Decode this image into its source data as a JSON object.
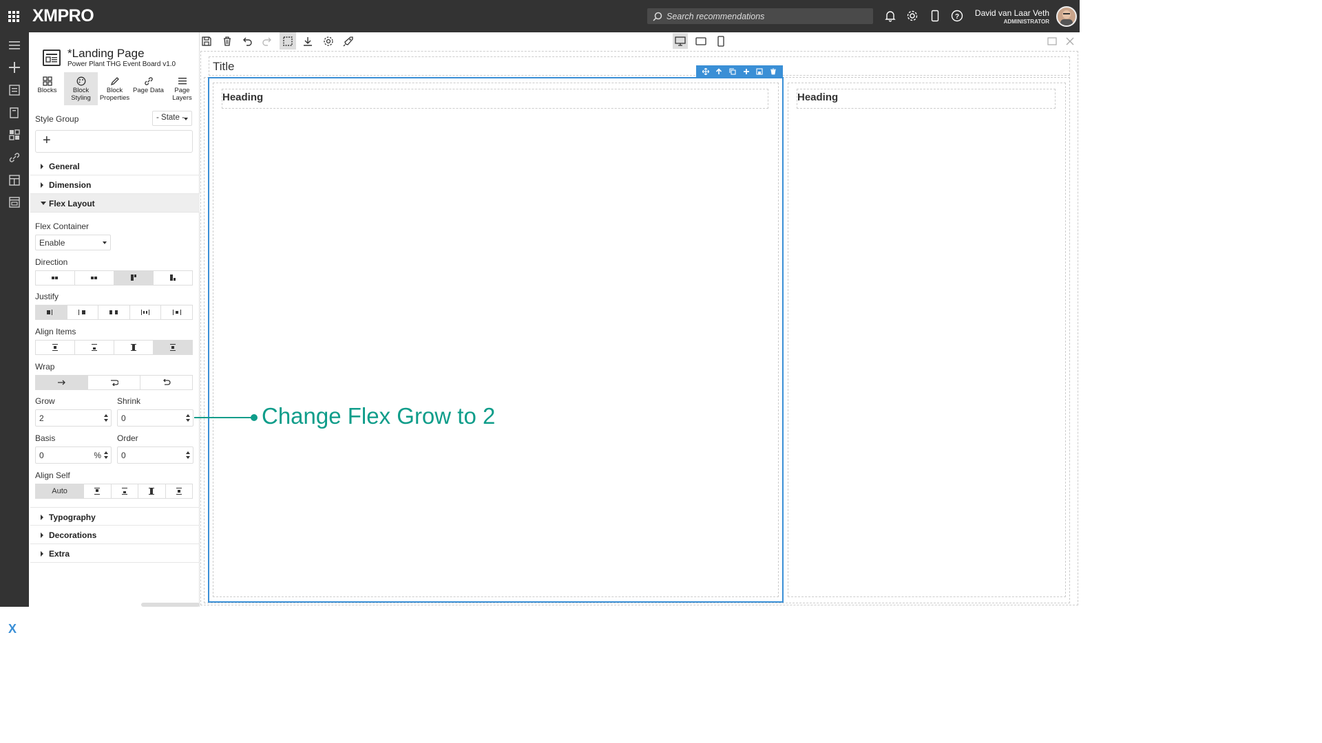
{
  "topbar": {
    "logo": "XMPRO",
    "search_placeholder": "Search recommendations",
    "user_name": "David van Laar Veth",
    "user_role": "ADMINISTRATOR",
    "icons": [
      "apps-icon",
      "bell-icon",
      "gear-icon",
      "mobile-icon",
      "help-icon"
    ]
  },
  "leftnav": {
    "icons": [
      "menu-icon",
      "plus-icon",
      "list-icon",
      "book-icon",
      "dashboard-icon",
      "link-icon",
      "table-icon",
      "window-icon"
    ],
    "bottom_logo": "X"
  },
  "panel": {
    "page_title": "*Landing Page",
    "page_subtitle": "Power Plant THG Event Board v1.0",
    "tabs": [
      {
        "label": "Blocks",
        "icon": "blocks-icon"
      },
      {
        "label": "Block Styling",
        "icon": "palette-icon"
      },
      {
        "label": "Block Properties",
        "icon": "pencil-icon"
      },
      {
        "label": "Page Data",
        "icon": "link-icon"
      },
      {
        "label": "Page Layers",
        "icon": "layers-icon"
      }
    ],
    "active_tab": "Block Styling",
    "style_group_label": "Style Group",
    "state_select": "- State -",
    "add_symbol": "+",
    "sections": {
      "general": "General",
      "dimension": "Dimension",
      "flex_layout": "Flex Layout",
      "typography": "Typography",
      "decorations": "Decorations",
      "extra": "Extra"
    },
    "flex": {
      "container_label": "Flex Container",
      "container_value": "Enable",
      "direction_label": "Direction",
      "justify_label": "Justify",
      "align_items_label": "Align Items",
      "wrap_label": "Wrap",
      "grow_label": "Grow",
      "grow_value": "2",
      "shrink_label": "Shrink",
      "shrink_value": "0",
      "basis_label": "Basis",
      "basis_value": "0",
      "basis_unit": "%",
      "order_label": "Order",
      "order_value": "0",
      "align_self_label": "Align Self",
      "align_self_auto": "Auto"
    }
  },
  "toolbar": {
    "icons": [
      "save-icon",
      "trash-icon",
      "undo-icon",
      "redo-icon",
      "select-icon",
      "download-icon",
      "settings-icon",
      "rocket-icon"
    ],
    "devices": [
      "desktop-icon",
      "tablet-icon",
      "phone-icon"
    ],
    "selected_device": "desktop"
  },
  "canvas": {
    "title": "Title",
    "heading_1": "Heading",
    "heading_2": "Heading"
  },
  "annotation": {
    "text": "Change Flex Grow to 2",
    "color": "#0f9d8a"
  },
  "colors": {
    "accent": "#3a8fd6",
    "topbar": "#333333"
  }
}
